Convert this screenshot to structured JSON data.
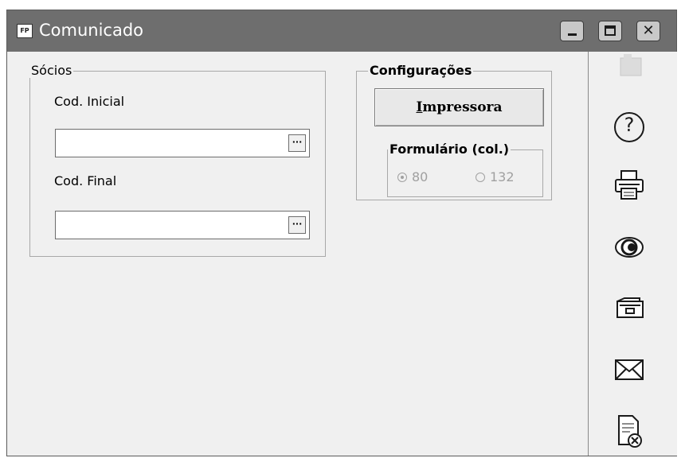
{
  "window": {
    "app_badge": "FP",
    "title": "Comunicado",
    "buttons": [
      "minimize",
      "maximize",
      "close"
    ],
    "close_glyph": "✕"
  },
  "socios_group": {
    "legend": "Sócios",
    "cod_inicial_label": "Cod. Inicial",
    "cod_inicial_value": "",
    "cod_final_label": "Cod. Final",
    "cod_final_value": "",
    "lookup_glyph": "···"
  },
  "config_group": {
    "legend": "Configurações",
    "printer_button_underlined": "I",
    "printer_button_rest": "mpressora",
    "form_group": {
      "legend": "Formulário (col.)",
      "options": [
        "80",
        "132"
      ],
      "selected": "80",
      "enabled": false
    }
  },
  "sidebar": {
    "icons": [
      "folder-icon",
      "help-icon",
      "printer-icon",
      "preview-eye-icon",
      "open-folder-icon",
      "mail-envelope-icon",
      "document-cancel-icon"
    ],
    "help_glyph": "?"
  }
}
